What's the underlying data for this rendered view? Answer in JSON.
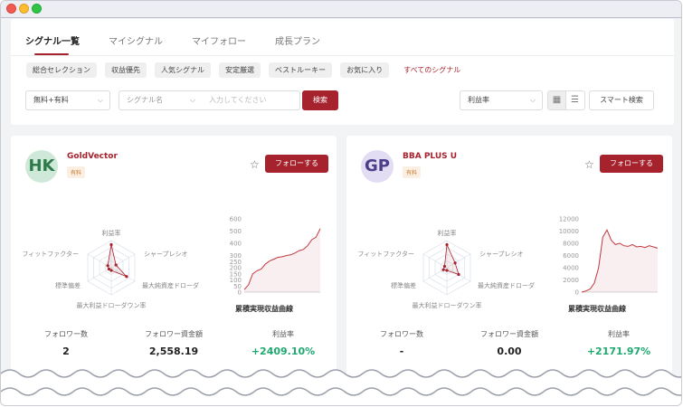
{
  "tabs": [
    "シグナル一覧",
    "マイシグナル",
    "マイフォロー",
    "成長プラン"
  ],
  "chips": [
    "総合セレクション",
    "収益優先",
    "人気シグナル",
    "安定厳選",
    "ベストルーキー",
    "お気に入り",
    "すべてのシグナル"
  ],
  "filters": {
    "type_select": "無料+有料",
    "name_select": "シグナル名",
    "input_placeholder": "入力してください",
    "search_button": "検索",
    "sort_select": "利益率",
    "smart_search": "スマート検索"
  },
  "colors": {
    "accent": "#a6232e",
    "positive": "#1fa971"
  },
  "radar_labels": [
    "利益率",
    "シャープレシオ",
    "最大純資産ドローダ",
    "最大利益ドローダウン率",
    "標準偏差",
    "フィットファクター"
  ],
  "curve_title": "累積実現収益曲線",
  "stat_labels": [
    "フォロワー数",
    "フォロワー資金額",
    "利益率"
  ],
  "follow_label": "フォローする",
  "signals": [
    {
      "initials": "HK",
      "name": "GoldVector",
      "badge": "有料",
      "followers": "2",
      "fund": "2,558.19",
      "profit": "+2409.10%",
      "radar_values": [
        0.85,
        0.2,
        0.65,
        0.1,
        0.1,
        0.15
      ],
      "chart_data": {
        "type": "area",
        "title": "累積実現収益曲線",
        "yticks": [
          "0",
          "50",
          "100",
          "150",
          "200",
          "250",
          "300",
          "400",
          "500",
          "600"
        ],
        "ylim": [
          0,
          600
        ],
        "y": [
          20,
          60,
          150,
          175,
          190,
          230,
          255,
          270,
          285,
          290,
          300,
          305,
          320,
          340,
          350,
          380,
          430,
          450,
          520
        ]
      }
    },
    {
      "initials": "GP",
      "name": "BBA PLUS U",
      "badge": "有料",
      "followers": "-",
      "fund": "0.00",
      "profit": "+2171.97%",
      "radar_values": [
        0.85,
        0.35,
        0.5,
        0.1,
        0.15,
        0.1
      ],
      "chart_data": {
        "type": "area",
        "title": "累積実現収益曲線",
        "yticks": [
          "0",
          "2000",
          "4000",
          "6000",
          "8000",
          "10000",
          "12000"
        ],
        "ylim": [
          0,
          12000
        ],
        "y": [
          0,
          200,
          500,
          1500,
          4000,
          9000,
          10200,
          8500,
          7800,
          8000,
          7600,
          7500,
          7800,
          7400,
          7500,
          7300,
          7600,
          7400,
          7200
        ]
      }
    }
  ]
}
